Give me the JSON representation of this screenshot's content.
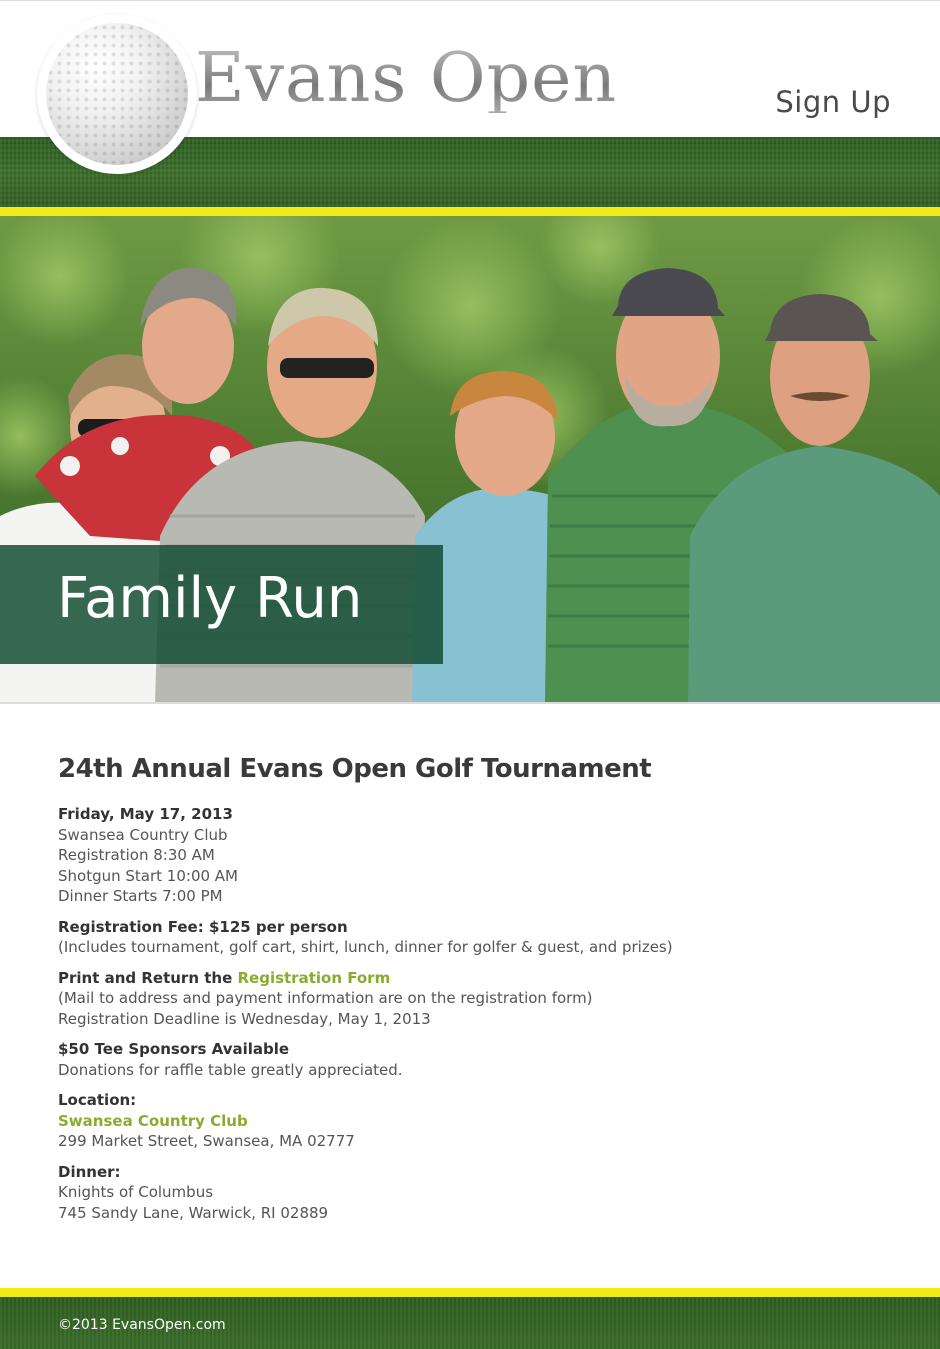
{
  "header": {
    "brand": "Evans Open",
    "signup_label": "Sign Up",
    "logo_icon": "golf-ball-icon"
  },
  "hero": {
    "caption": "Family Run"
  },
  "event": {
    "title": "24th Annual Evans Open Golf Tournament",
    "schedule": {
      "date": "Friday, May 17, 2013",
      "venue": "Swansea Country Club",
      "registration": "Registration 8:30 AM",
      "shotgun": "Shotgun Start 10:00 AM",
      "dinner": "Dinner Starts 7:00 PM"
    },
    "fee": {
      "heading": "Registration Fee: $125 per person",
      "detail": "(Includes tournament, golf cart, shirt, lunch, dinner for golfer & guest, and prizes)"
    },
    "form": {
      "heading_prefix": "Print and Return the ",
      "link_label": "Registration Form",
      "note": "(Mail to address and payment information are on the registration form)",
      "deadline": "Registration Deadline is Wednesday, May 1, 2013"
    },
    "sponsors": {
      "heading": "$50 Tee Sponsors Available",
      "detail": "Donations for raffle table greatly appreciated."
    },
    "location": {
      "heading": "Location:",
      "link_label": "Swansea Country Club",
      "address": "299 Market Street, Swansea, MA 02777"
    },
    "dinner": {
      "heading": "Dinner:",
      "venue": "Knights of Columbus",
      "address": "745 Sandy Lane, Warwick, RI 02889"
    }
  },
  "footer": {
    "copyright": "©2013 EvansOpen.com"
  },
  "colors": {
    "accent_green": "#8aac2e",
    "banner_green": "#3b6f2a",
    "stripe_yellow": "#f1ea16",
    "caption_green": "#144e34"
  }
}
